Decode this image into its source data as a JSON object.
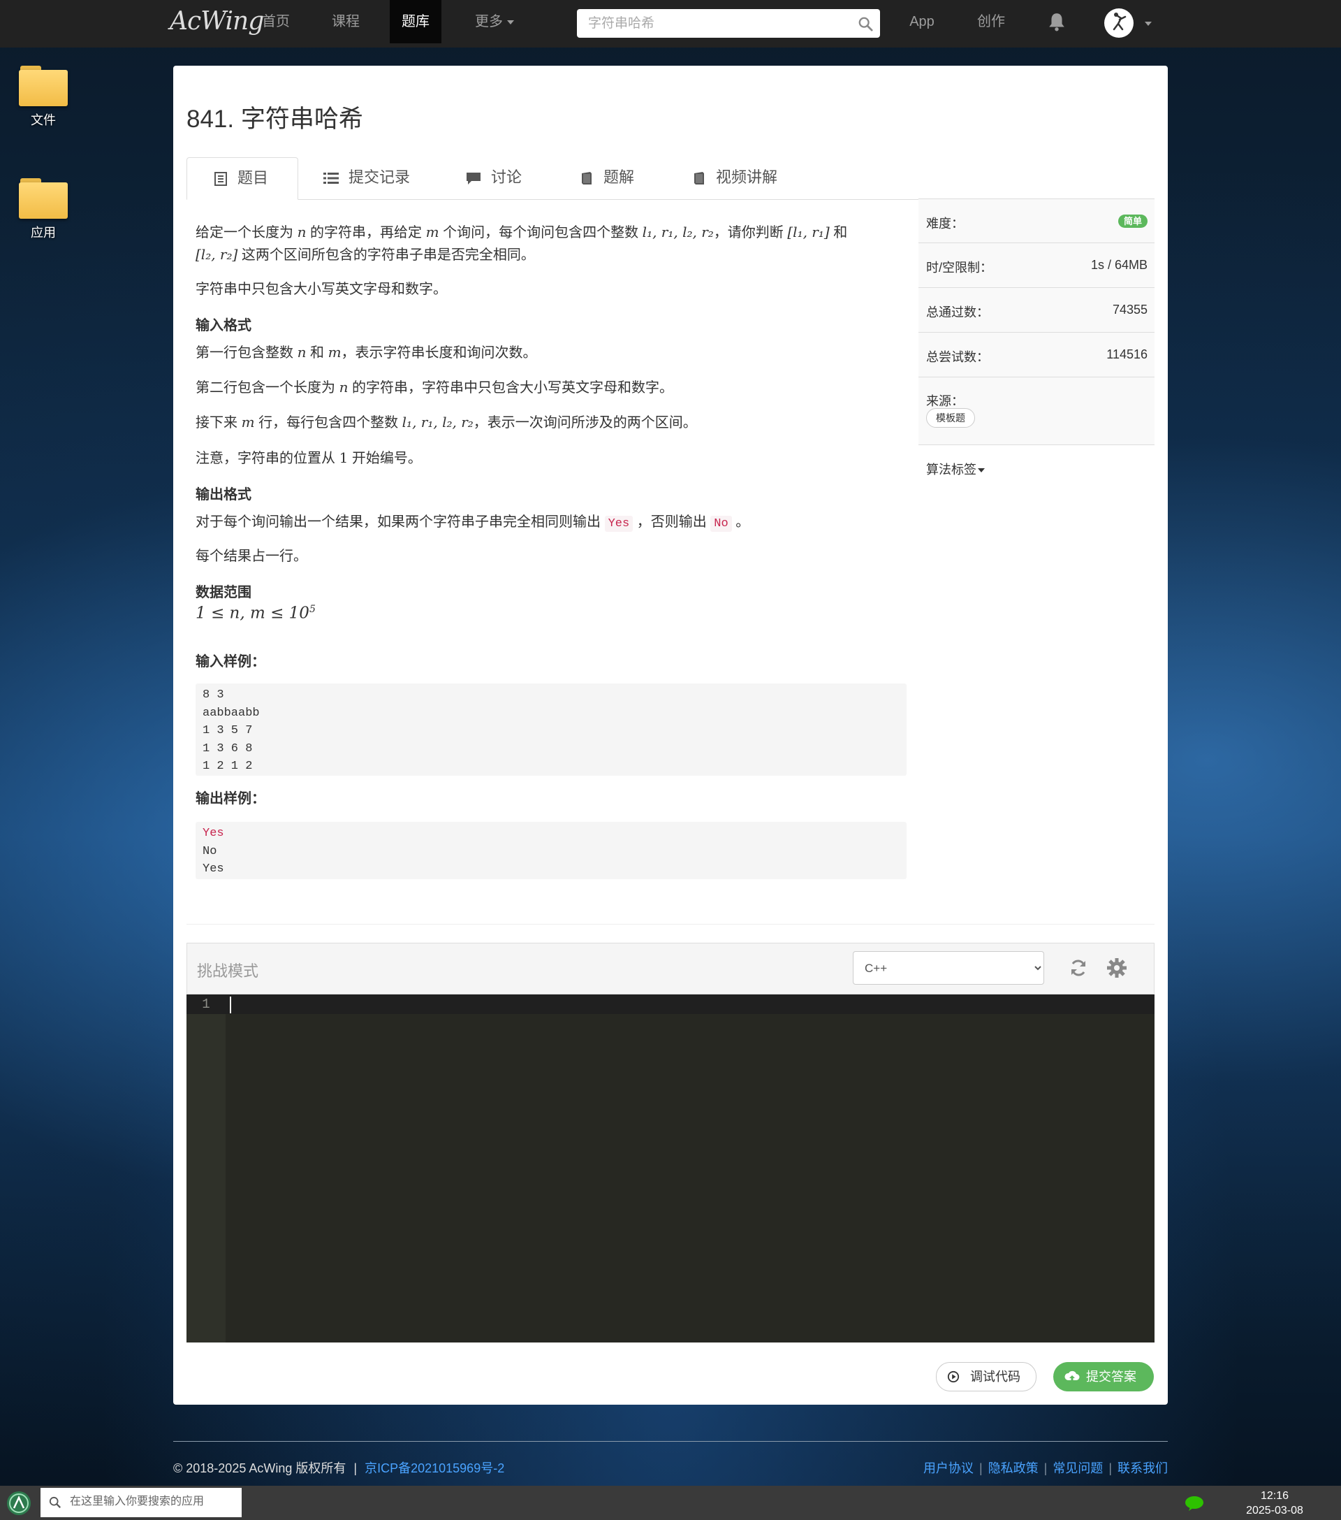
{
  "navbar": {
    "brand": "AcWing",
    "links": [
      "首页",
      "课程",
      "题库",
      "更多",
      "App",
      "创作"
    ],
    "active_link": "题库",
    "search_placeholder": "字符串哈希"
  },
  "desktop": {
    "icons": [
      {
        "label": "文件",
        "icon": "folder-icon"
      },
      {
        "label": "应用",
        "icon": "folder-icon"
      }
    ]
  },
  "problem": {
    "title": "841. 字符串哈希",
    "tabs": [
      {
        "label": "题目",
        "icon": "document-icon"
      },
      {
        "label": "提交记录",
        "icon": "list-icon"
      },
      {
        "label": "讨论",
        "icon": "comment-icon"
      },
      {
        "label": "题解",
        "icon": "book-icon"
      },
      {
        "label": "视频讲解",
        "icon": "video-book-icon"
      }
    ],
    "active_tab": "题目",
    "description": {
      "p1_a": "给定一个长度为",
      "p1_var_n": "n",
      "p1_b": "的字符串，再给定",
      "p1_var_m": "m",
      "p1_c": "个询问，每个询问包含四个整数",
      "p1_vars": "l₁, r₁, l₂, r₂",
      "p1_d": "，请你判断",
      "p1_range1": "[l₁, r₁]",
      "p1_e": "和",
      "p1_range2": "[l₂, r₂]",
      "p1_f": "这两个区间所包含的字符串子串是否完全相同。",
      "p2": "字符串中只包含大小写英文字母和数字。"
    },
    "input_format": {
      "heading": "输入格式",
      "l1_a": "第一行包含整数",
      "l1_n": "n",
      "l1_b": "和",
      "l1_m": "m",
      "l1_c": "，表示字符串长度和询问次数。",
      "l2_a": "第二行包含一个长度为",
      "l2_n": "n",
      "l2_b": "的字符串，字符串中只包含大小写英文字母和数字。",
      "l3_a": "接下来",
      "l3_m": "m",
      "l3_b": "行，每行包含四个整数",
      "l3_vars": "l₁, r₁, l₂, r₂",
      "l3_c": "，表示一次询问所涉及的两个区间。",
      "l4_a": "注意，字符串的位置从",
      "l4_one": "1",
      "l4_b": "开始编号。"
    },
    "output_format": {
      "heading": "输出格式",
      "l1_a": "对于每个询问输出一个结果，如果两个字符串子串完全相同则输出",
      "l1_yes": "Yes",
      "l1_b": "，否则输出",
      "l1_no": "No",
      "l1_c": "。",
      "l2": "每个结果占一行。"
    },
    "data_range": {
      "heading": "数据范围",
      "formula_lhs": "1 ≤ n, m ≤ 10",
      "formula_exp": "5"
    },
    "sample_input": {
      "heading": "输入样例：",
      "lines": [
        "8 3",
        "aabbaabb",
        "1 3 5 7",
        "1 3 6 8",
        "1 2 1 2"
      ]
    },
    "sample_output": {
      "heading": "输出样例：",
      "lines": [
        "Yes",
        "No",
        "Yes"
      ]
    }
  },
  "sidebar": {
    "difficulty_label": "难度：",
    "difficulty_value": "简单",
    "limit_label": "时/空限制：",
    "limit_value": "1s / 64MB",
    "passed_label": "总通过数：",
    "passed_value": "74355",
    "attempts_label": "总尝试数：",
    "attempts_value": "114516",
    "source_label": "来源：",
    "source_tag": "模板题",
    "algo_tags_label": "算法标签"
  },
  "editor": {
    "mode_label": "挑战模式",
    "language": "C++",
    "line_number": "1",
    "debug_button": "调试代码",
    "submit_button": "提交答案"
  },
  "footer": {
    "copyright": "© 2018-2025 AcWing 版权所有",
    "icp": "京ICP备2021015969号-2",
    "links": [
      "用户协议",
      "隐私政策",
      "常见问题",
      "联系我们"
    ]
  },
  "taskbar": {
    "search_placeholder": "在这里输入你要搜索的应用",
    "time": "12:16",
    "date": "2025-03-08"
  },
  "colors": {
    "navbar_bg": "#222222",
    "accent_green": "#5cb85c",
    "link_blue": "#4aa3ff",
    "editor_bg": "#272822"
  }
}
